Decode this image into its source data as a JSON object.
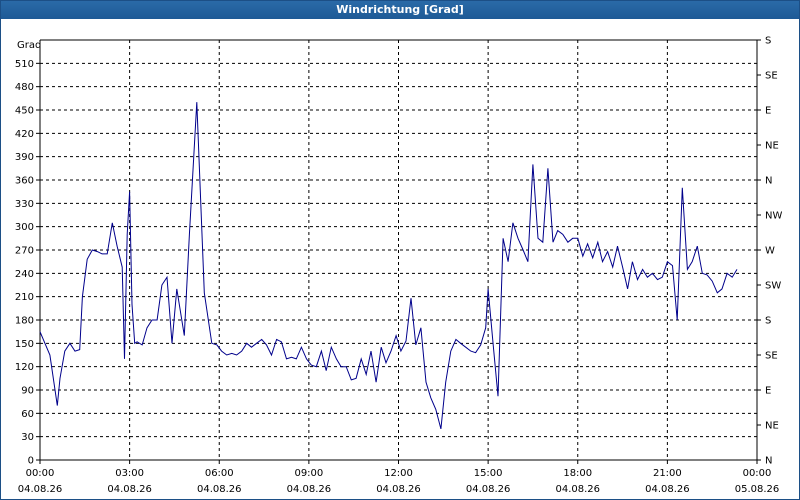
{
  "window": {
    "title": "Windrichtung [Grad]"
  },
  "chart_data": {
    "type": "line",
    "title": "Windrichtung [Grad]",
    "ylabel": "Grad",
    "ylim": [
      0,
      540
    ],
    "grid": true,
    "y_ticks_left": [
      "0",
      "30",
      "60",
      "90",
      "120",
      "150",
      "180",
      "210",
      "240",
      "270",
      "300",
      "330",
      "360",
      "390",
      "420",
      "450",
      "480",
      "510"
    ],
    "y_ticks_right": [
      "N",
      "NE",
      "E",
      "SE",
      "S",
      "SW",
      "W",
      "NW",
      "N",
      "NE",
      "E",
      "SE",
      "S"
    ],
    "y_ticks_right_values": [
      0,
      45,
      90,
      135,
      180,
      225,
      270,
      315,
      360,
      405,
      450,
      495,
      540
    ],
    "x_ticks": [
      {
        "time": "00:00",
        "date": "04.08.26"
      },
      {
        "time": "03:00",
        "date": "04.08.26"
      },
      {
        "time": "06:00",
        "date": "04.08.26"
      },
      {
        "time": "09:00",
        "date": "04.08.26"
      },
      {
        "time": "12:00",
        "date": "04.08.26"
      },
      {
        "time": "15:00",
        "date": "04.08.26"
      },
      {
        "time": "18:00",
        "date": "04.08.26"
      },
      {
        "time": "21:00",
        "date": "04.08.26"
      },
      {
        "time": "00:00",
        "date": "05.08.26"
      }
    ],
    "series": [
      {
        "color": "#00008b",
        "x_hours": [
          0,
          0.33,
          0.58,
          0.67,
          0.83,
          1.0,
          1.17,
          1.33,
          1.42,
          1.58,
          1.75,
          1.92,
          2.08,
          2.25,
          2.42,
          2.58,
          2.75,
          2.83,
          2.92,
          3.0,
          3.08,
          3.17,
          3.25,
          3.42,
          3.58,
          3.75,
          3.92,
          4.08,
          4.25,
          4.42,
          4.58,
          4.83,
          5.0,
          5.25,
          5.5,
          5.75,
          5.92,
          6.08,
          6.25,
          6.42,
          6.58,
          6.75,
          6.92,
          7.08,
          7.25,
          7.42,
          7.58,
          7.75,
          7.92,
          8.08,
          8.25,
          8.42,
          8.58,
          8.75,
          8.92,
          9.08,
          9.25,
          9.42,
          9.58,
          9.75,
          9.92,
          10.08,
          10.25,
          10.42,
          10.58,
          10.75,
          10.92,
          11.08,
          11.25,
          11.42,
          11.58,
          11.75,
          11.92,
          12.08,
          12.25,
          12.42,
          12.58,
          12.75,
          12.92,
          13.08,
          13.25,
          13.42,
          13.58,
          13.75,
          13.92,
          14.08,
          14.25,
          14.42,
          14.58,
          14.75,
          14.92,
          15.0,
          15.17,
          15.33,
          15.5,
          15.67,
          15.83,
          16.0,
          16.17,
          16.33,
          16.5,
          16.67,
          16.83,
          17.0,
          17.17,
          17.33,
          17.5,
          17.67,
          17.83,
          18.0,
          18.17,
          18.33,
          18.5,
          18.67,
          18.83,
          19.0,
          19.17,
          19.33,
          19.5,
          19.67,
          19.83,
          20.0,
          20.17,
          20.33,
          20.5,
          20.67,
          20.83,
          21.0,
          21.17,
          21.33,
          21.5,
          21.67,
          21.83,
          22.0,
          22.17,
          22.33,
          22.5,
          22.67,
          22.83,
          23.0,
          23.17,
          23.33,
          23.5,
          23.67,
          23.83,
          24.0
        ],
        "y": [
          165,
          135,
          70,
          105,
          140,
          150,
          140,
          142,
          210,
          258,
          270,
          268,
          265,
          265,
          305,
          275,
          248,
          130,
          290,
          345,
          200,
          150,
          152,
          148,
          170,
          180,
          180,
          225,
          235,
          150,
          220,
          160,
          290,
          460,
          215,
          150,
          148,
          140,
          135,
          137,
          135,
          140,
          150,
          145,
          150,
          155,
          148,
          135,
          155,
          152,
          130,
          132,
          130,
          145,
          130,
          122,
          120,
          140,
          115,
          145,
          130,
          120,
          120,
          103,
          105,
          130,
          110,
          140,
          100,
          145,
          125,
          140,
          160,
          140,
          153,
          208,
          148,
          170,
          100,
          80,
          65,
          40,
          100,
          140,
          155,
          150,
          145,
          140,
          138,
          148,
          170,
          220,
          148,
          82,
          285,
          255,
          305,
          285,
          270,
          255,
          380,
          285,
          280,
          375,
          280,
          295,
          290,
          280,
          285,
          285,
          262,
          278,
          260,
          280,
          255,
          268,
          248,
          275,
          248,
          220,
          255,
          232,
          245,
          235,
          240,
          232,
          235,
          255,
          250,
          180,
          350,
          245,
          255,
          275,
          240,
          238,
          230,
          215,
          220,
          240,
          235,
          245
        ]
      }
    ]
  }
}
